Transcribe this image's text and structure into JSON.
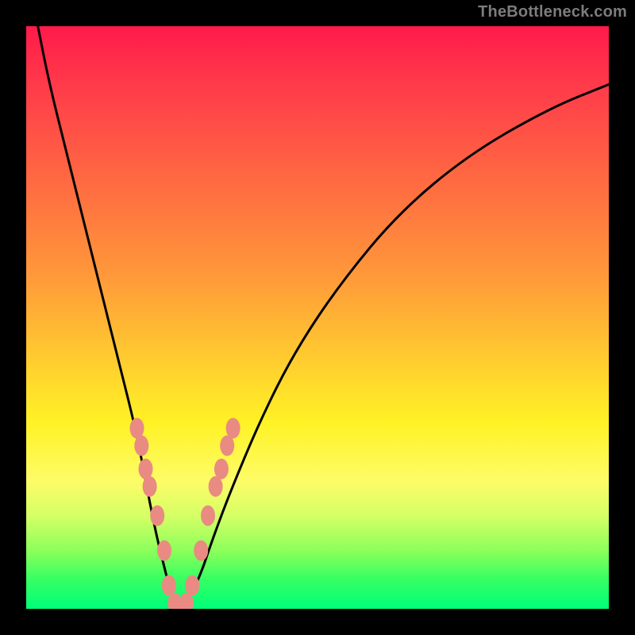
{
  "watermark": "TheBottleneck.com",
  "chart_data": {
    "type": "line",
    "title": "",
    "xlabel": "",
    "ylabel": "",
    "xlim": [
      0,
      100
    ],
    "ylim": [
      0,
      100
    ],
    "grid": false,
    "legend": false,
    "annotations": [],
    "series": [
      {
        "name": "bottleneck-curve",
        "x": [
          2,
          4,
          7,
          10,
          13,
          16,
          19,
          22,
          24,
          25,
          26,
          27,
          28,
          30,
          32,
          35,
          40,
          46,
          54,
          64,
          76,
          90,
          100
        ],
        "y": [
          100,
          90,
          78,
          66,
          54,
          42,
          30,
          14,
          6,
          2,
          0.5,
          0.5,
          2,
          6,
          12,
          20,
          32,
          44,
          56,
          68,
          78,
          86,
          90
        ],
        "color": "#000000"
      }
    ],
    "markers": [
      {
        "name": "left-cluster",
        "color": "#e98b82",
        "points": [
          {
            "x": 19.0,
            "y": 31
          },
          {
            "x": 19.8,
            "y": 28
          },
          {
            "x": 20.5,
            "y": 24
          },
          {
            "x": 21.2,
            "y": 21
          },
          {
            "x": 22.5,
            "y": 16
          },
          {
            "x": 23.7,
            "y": 10
          },
          {
            "x": 24.5,
            "y": 4
          },
          {
            "x": 25.5,
            "y": 1
          }
        ]
      },
      {
        "name": "right-cluster",
        "color": "#e98b82",
        "points": [
          {
            "x": 27.5,
            "y": 1
          },
          {
            "x": 28.5,
            "y": 4
          },
          {
            "x": 30.0,
            "y": 10
          },
          {
            "x": 31.2,
            "y": 16
          },
          {
            "x": 32.5,
            "y": 21
          },
          {
            "x": 33.5,
            "y": 24
          },
          {
            "x": 34.5,
            "y": 28
          },
          {
            "x": 35.5,
            "y": 31
          }
        ]
      }
    ]
  }
}
